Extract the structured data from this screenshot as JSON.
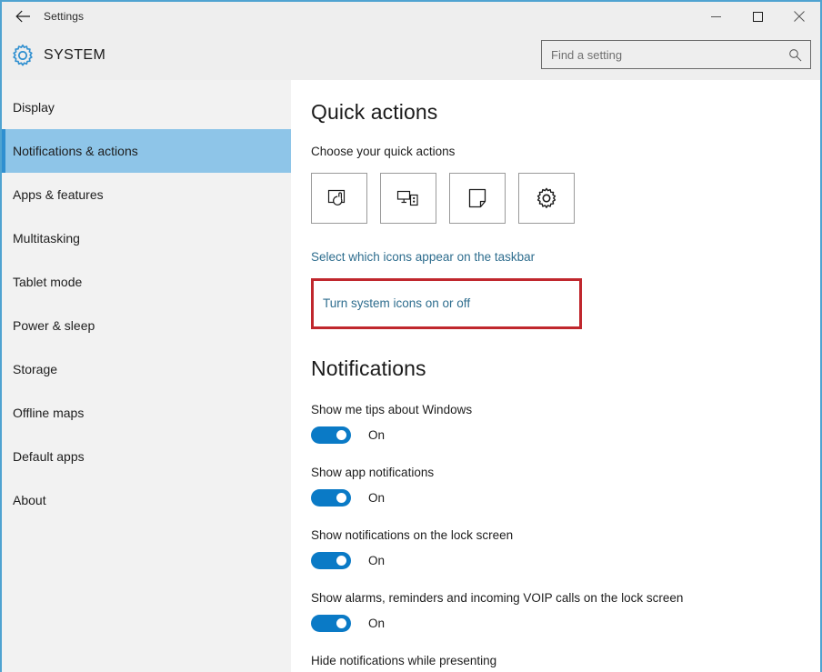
{
  "window": {
    "title": "Settings",
    "back_icon": "back-arrow-icon",
    "minimize_label": "Minimize",
    "maximize_label": "Maximize",
    "close_label": "Close",
    "border_color": "#4fa3d1"
  },
  "header": {
    "brand_icon": "gear-icon",
    "brand_title": "SYSTEM",
    "search": {
      "placeholder": "Find a setting",
      "value": "",
      "icon": "search-icon"
    }
  },
  "sidebar": {
    "items": [
      {
        "label": "Display",
        "selected": false
      },
      {
        "label": "Notifications & actions",
        "selected": true
      },
      {
        "label": "Apps & features",
        "selected": false
      },
      {
        "label": "Multitasking",
        "selected": false
      },
      {
        "label": "Tablet mode",
        "selected": false
      },
      {
        "label": "Power & sleep",
        "selected": false
      },
      {
        "label": "Storage",
        "selected": false
      },
      {
        "label": "Offline maps",
        "selected": false
      },
      {
        "label": "Default apps",
        "selected": false
      },
      {
        "label": "About",
        "selected": false
      }
    ],
    "selected_bg": "#8ec5e8",
    "accent_bar": "#2f8fd0"
  },
  "content": {
    "quick_actions": {
      "heading": "Quick actions",
      "subheading": "Choose your quick actions",
      "tiles": [
        {
          "icon": "tablet-mode-icon",
          "label": "Tablet mode"
        },
        {
          "icon": "connect-project-icon",
          "label": "Connect"
        },
        {
          "icon": "note-icon",
          "label": "Note"
        },
        {
          "icon": "all-settings-gear-icon",
          "label": "All settings"
        }
      ]
    },
    "links": [
      {
        "label": "Select which icons appear on the taskbar",
        "highlighted": false
      },
      {
        "label": "Turn system icons on or off",
        "highlighted": true
      }
    ],
    "highlight_color": "#c0272d",
    "link_color": "#2e6d8e",
    "notifications": {
      "heading": "Notifications",
      "settings": [
        {
          "label": "Show me tips about Windows",
          "state": "On",
          "on": true
        },
        {
          "label": "Show app notifications",
          "state": "On",
          "on": true
        },
        {
          "label": "Show notifications on the lock screen",
          "state": "On",
          "on": true
        },
        {
          "label": "Show alarms, reminders and incoming VOIP calls on the lock screen",
          "state": "On",
          "on": true
        }
      ],
      "cut_off_setting": {
        "label": "Hide notifications while presenting"
      },
      "toggle_on_color": "#0a7ac6"
    }
  }
}
